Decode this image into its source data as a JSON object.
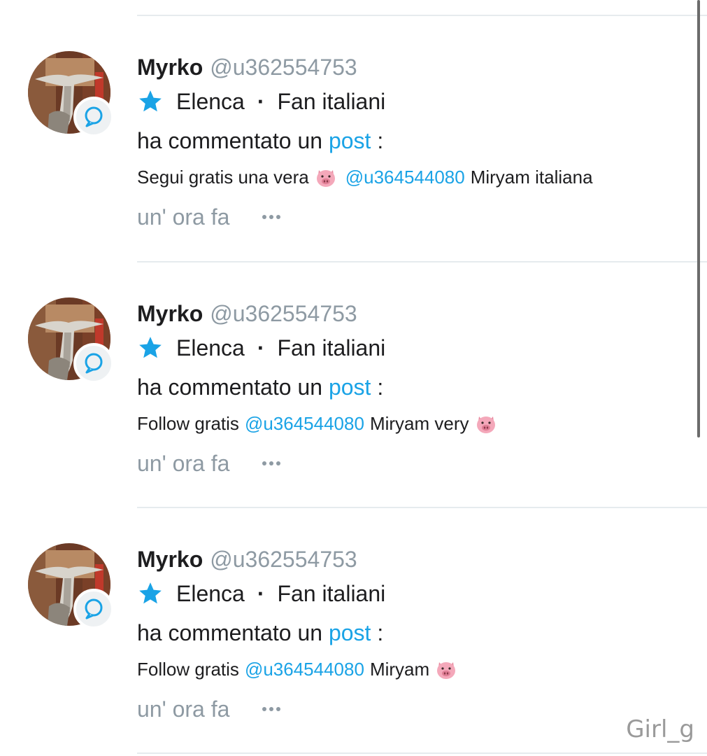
{
  "feed": {
    "items": [
      {
        "user_name": "Myrko",
        "user_handle": "@u362554753",
        "list_name": "Elenca",
        "list_separator": "·",
        "list_group": "Fan italiani",
        "action_text": "ha commentato un",
        "action_link": "post",
        "action_colon": ":",
        "comment_before": "Segui gratis una vera",
        "comment_mention": "@u364544080",
        "comment_after": "Miryam italiana",
        "pig_position": "before-mention",
        "time": "un' ora fa"
      },
      {
        "user_name": "Myrko",
        "user_handle": "@u362554753",
        "list_name": "Elenca",
        "list_separator": "·",
        "list_group": "Fan italiani",
        "action_text": "ha commentato un",
        "action_link": "post",
        "action_colon": ":",
        "comment_before": "Follow gratis",
        "comment_mention": "@u364544080",
        "comment_after": "Miryam very",
        "pig_position": "end",
        "time": "un' ora fa"
      },
      {
        "user_name": "Myrko",
        "user_handle": "@u362554753",
        "list_name": "Elenca",
        "list_separator": "·",
        "list_group": "Fan italiani",
        "action_text": "ha commentato un",
        "action_link": "post",
        "action_colon": ":",
        "comment_before": "Follow gratis",
        "comment_mention": "@u364544080",
        "comment_after": "Miryam",
        "pig_position": "end",
        "time": "un' ora fa"
      }
    ]
  },
  "icons": {
    "star": "star-icon",
    "comment_badge": "comment-bubble-icon",
    "more": "more-horizontal-icon",
    "emoji": "pig-face-emoji"
  },
  "colors": {
    "accent": "#1aa3e6",
    "muted": "#8e9aa3",
    "text": "#1d1d1f",
    "divider": "#e6ebee"
  },
  "watermark": "Girl_g"
}
